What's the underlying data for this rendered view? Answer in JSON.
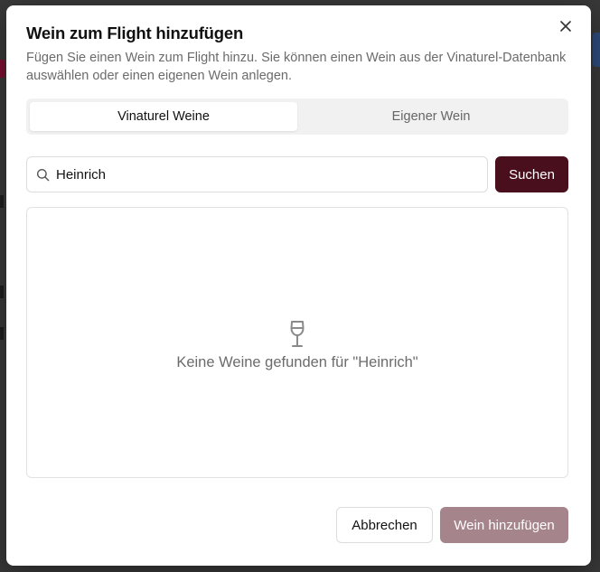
{
  "dialog": {
    "title": "Wein zum Flight hinzufügen",
    "subtitle": "Fügen Sie einen Wein zum Flight hinzu. Sie können einen Wein aus der Vinaturel-Datenbank auswählen oder einen eigenen Wein anlegen.",
    "close_icon": "×"
  },
  "tabs": [
    {
      "label": "Vinaturel Weine",
      "active": true
    },
    {
      "label": "Eigener Wein",
      "active": false
    }
  ],
  "search": {
    "value": "Heinrich",
    "button_label": "Suchen"
  },
  "results": {
    "empty_message": "Keine Weine gefunden für \"Heinrich\"",
    "icon": "wine-glass-icon"
  },
  "footer": {
    "cancel_label": "Abbrechen",
    "add_label": "Wein hinzufügen"
  },
  "colors": {
    "primary": "#4a0f1c",
    "primary_disabled": "#a6848b"
  }
}
